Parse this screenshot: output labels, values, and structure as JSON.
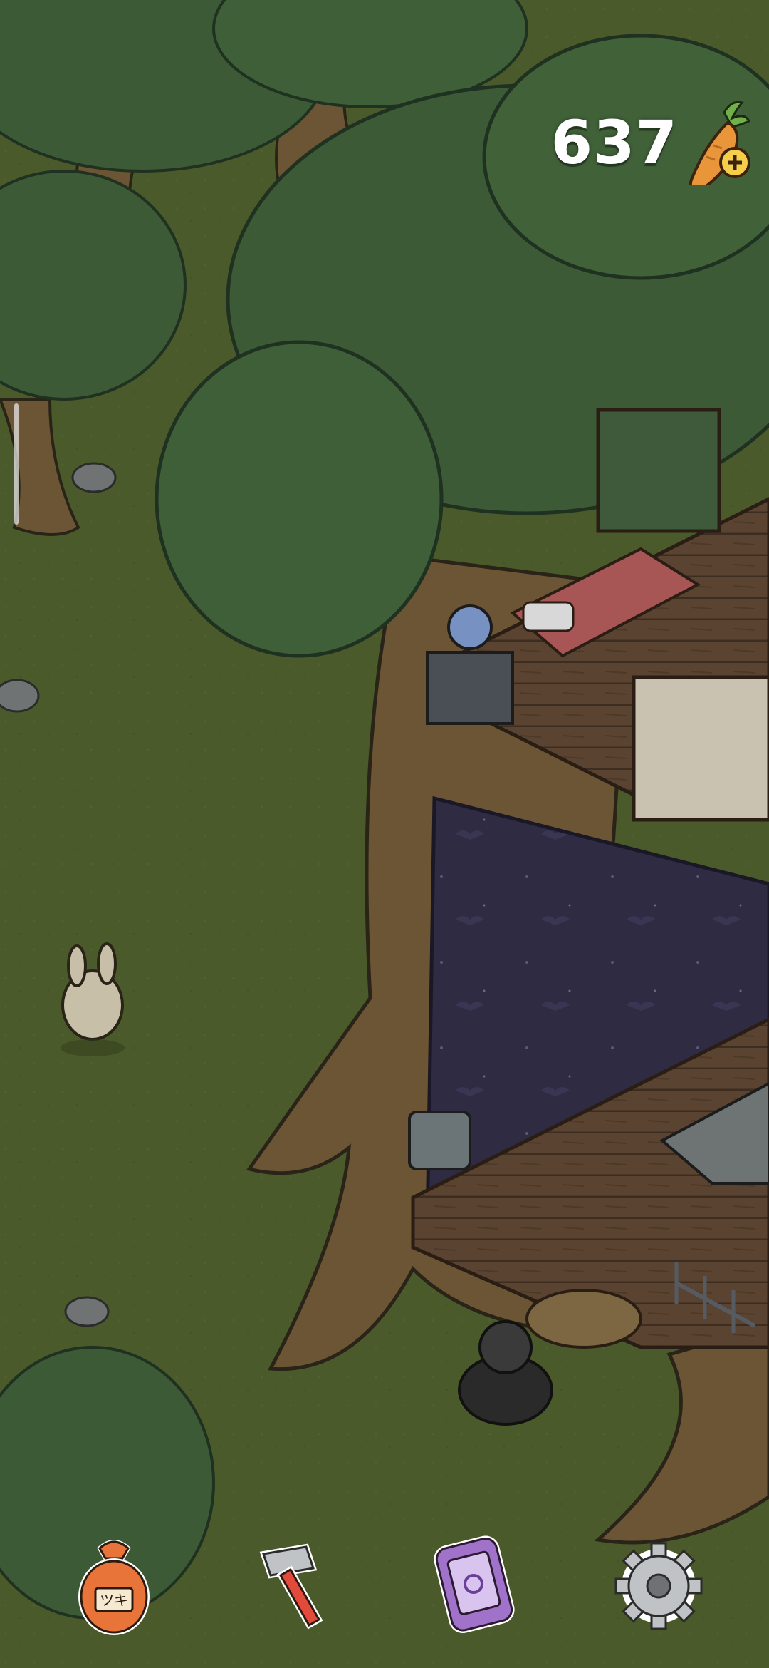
{
  "hud": {
    "carrot_count": "637",
    "carrot_icon": "carrot-add-icon"
  },
  "toolbar": {
    "items": [
      {
        "name": "bag-button",
        "icon": "bag-icon",
        "bag_label": "ツキ"
      },
      {
        "name": "build-button",
        "icon": "hammer-icon"
      },
      {
        "name": "phone-button",
        "icon": "phone-icon"
      },
      {
        "name": "settings-button",
        "icon": "gear-icon"
      }
    ]
  },
  "colors": {
    "grass": "#4b5a2b",
    "grass_dark": "#435226",
    "tree_canopy": "#3c5a36",
    "tree_canopy_light": "#4a6b42",
    "trunk": "#6b5535",
    "floor_wood": "#5a4331",
    "night_wall": "#2f2c44",
    "text_white": "#ffffff",
    "carrot_orange": "#e9953a"
  }
}
